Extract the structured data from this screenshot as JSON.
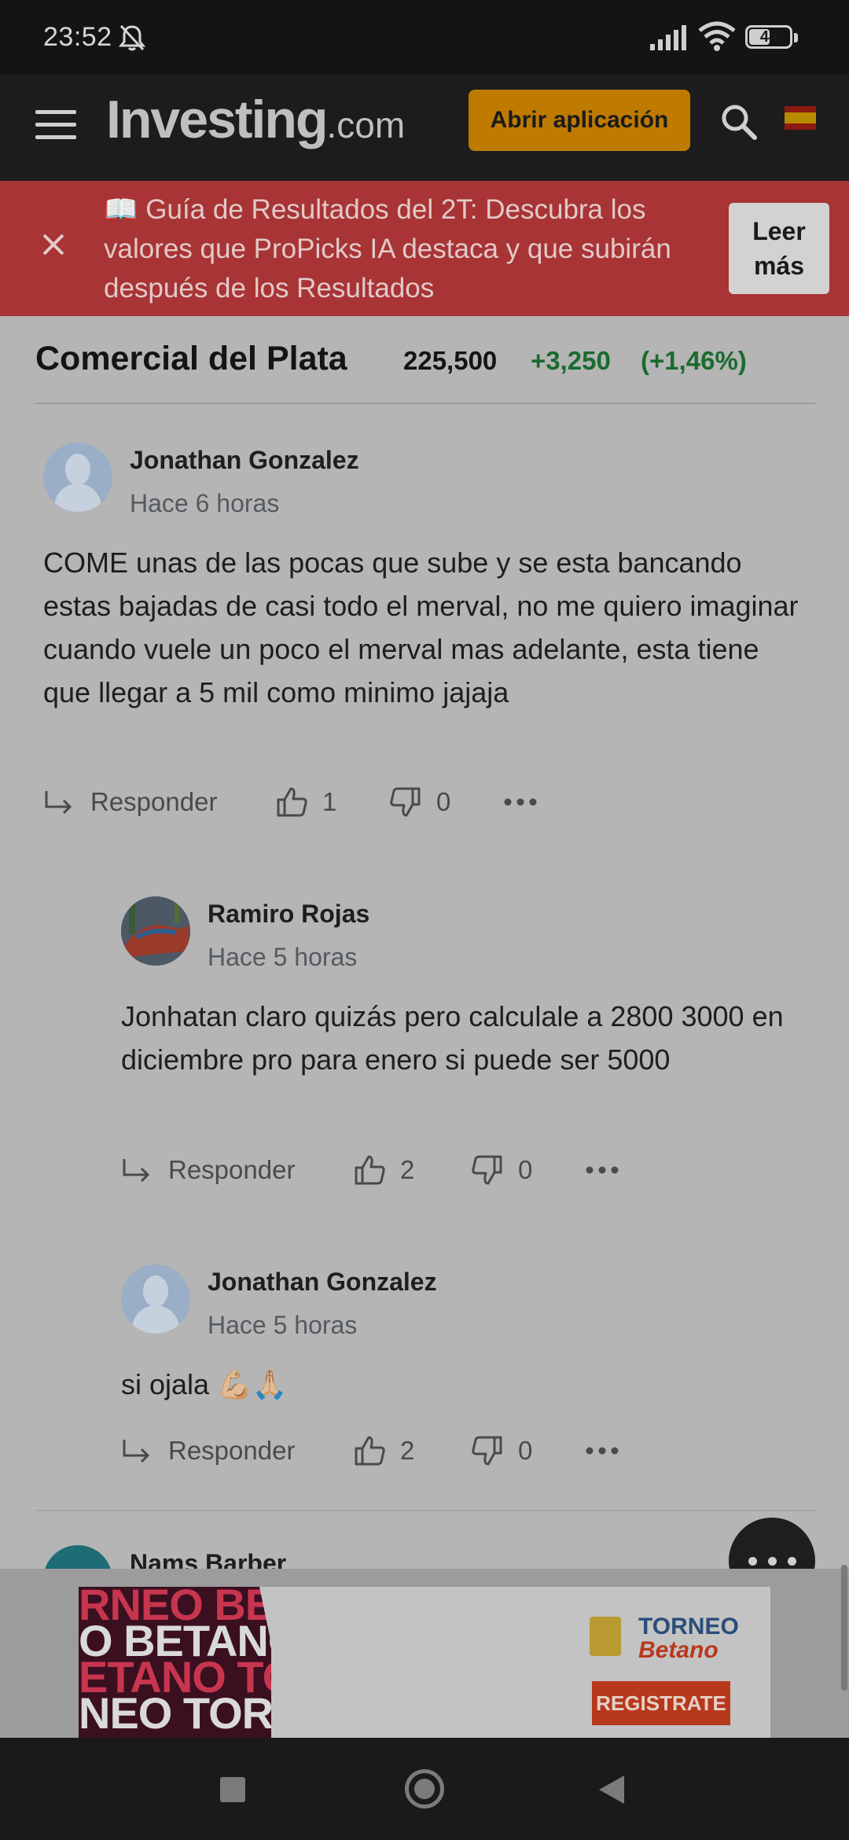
{
  "status_bar": {
    "time": "23:52",
    "battery": "44",
    "icons": [
      "bell-off-icon",
      "signal-icon",
      "wifi-icon",
      "battery-icon"
    ]
  },
  "header": {
    "logo_main": "Investing",
    "logo_suffix": ".com",
    "open_app_label": "Abrir aplicación",
    "icons": [
      "menu-icon",
      "search-icon",
      "spain-flag-icon"
    ]
  },
  "banner": {
    "text": "📖 Guía de Resultados del 2T: Descubra los valores que ProPicks IA destaca y que subirán después de los Resultados",
    "button_label": "Leer más"
  },
  "stock": {
    "name": "Comercial del Plata",
    "price": "225,500",
    "change": "+3,250",
    "change_pct": "(+1,46%)"
  },
  "comments": [
    {
      "author": "Jonathan Gonzalez",
      "time": "Hace 6 horas",
      "text": "COME unas de las pocas que sube y se esta bancando estas bajadas de casi todo el merval, no me quiero imaginar cuando vuele un poco el merval mas adelante, esta tiene que llegar a 5 mil como minimo jajaja",
      "reply_label": "Responder",
      "likes": "1",
      "dislikes": "0"
    },
    {
      "author": "Ramiro Rojas",
      "time": "Hace 5 horas",
      "text": "Jonhatan claro quizás pero calculale a 2800 3000 en diciembre pro para enero si puede ser 5000",
      "reply_label": "Responder",
      "likes": "2",
      "dislikes": "0"
    },
    {
      "author": "Jonathan Gonzalez",
      "time": "Hace 5 horas",
      "text": "si ojala 💪🏼🙏🏼",
      "reply_label": "Responder",
      "likes": "2",
      "dislikes": "0"
    },
    {
      "author": "Nams Barber"
    }
  ],
  "ad": {
    "art_text": [
      "RNEO BETAN",
      "O BETANO",
      "ETANO TOR",
      "NEO TORN"
    ],
    "brand_line1": "TORNEO",
    "brand_line2": "Betano",
    "cta": "REGISTRATE"
  }
}
